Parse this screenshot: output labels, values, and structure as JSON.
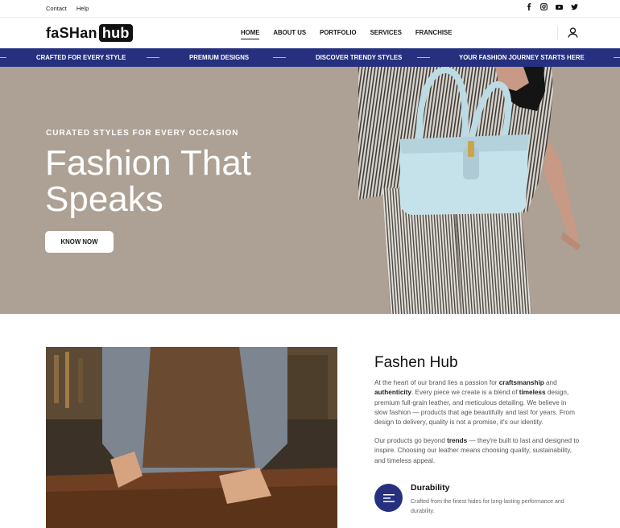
{
  "topbar": {
    "links": [
      "Contact",
      "Help"
    ],
    "social": [
      "facebook-icon",
      "instagram-icon",
      "youtube-icon",
      "twitter-icon"
    ]
  },
  "header": {
    "logo_part1": "faSHan",
    "logo_part2": "hub",
    "nav": [
      "HOME",
      "ABOUT US",
      "PORTFOLIO",
      "SERVICES",
      "FRANCHISE"
    ],
    "active_nav": "HOME",
    "user_icon": "user-icon"
  },
  "ticker": {
    "items": [
      "CRAFTED FOR EVERY STYLE",
      "PREMIUM DESIGNS",
      "DISCOVER TRENDY STYLES",
      "YOUR FASHION JOURNEY STARTS HERE"
    ]
  },
  "hero": {
    "kicker": "CURATED STYLES FOR EVERY OCCASION",
    "title_line1": "Fashion That",
    "title_line2": "Speaks",
    "cta": "KNOW NOW"
  },
  "about": {
    "title": "Fashen Hub",
    "p1": {
      "a": "At the heart of our brand lies a passion for ",
      "b": "craftsmanship",
      "c": " and ",
      "d": "authenticity",
      "e": ". Every piece we create is a blend of ",
      "f": "timeless",
      "g": " design, premium full-grain leather, and meticulous detailing. We believe in slow fashion — products that age beautifully and last for years. From design to delivery, quality is not a promise, it's our identity."
    },
    "p2": {
      "a": "Our products go beyond ",
      "b": "trends",
      "c": " — they're built to last and designed to inspire. Choosing our leather means choosing quality, sustainability, and timeless appeal."
    },
    "feature": {
      "icon": "menu-lines-icon",
      "title": "Durability",
      "desc": "Crafted from the finest hides for long-lasting performance and durability."
    }
  },
  "colors": {
    "brand_navy": "#26307e",
    "hero_bg": "#ada094"
  }
}
